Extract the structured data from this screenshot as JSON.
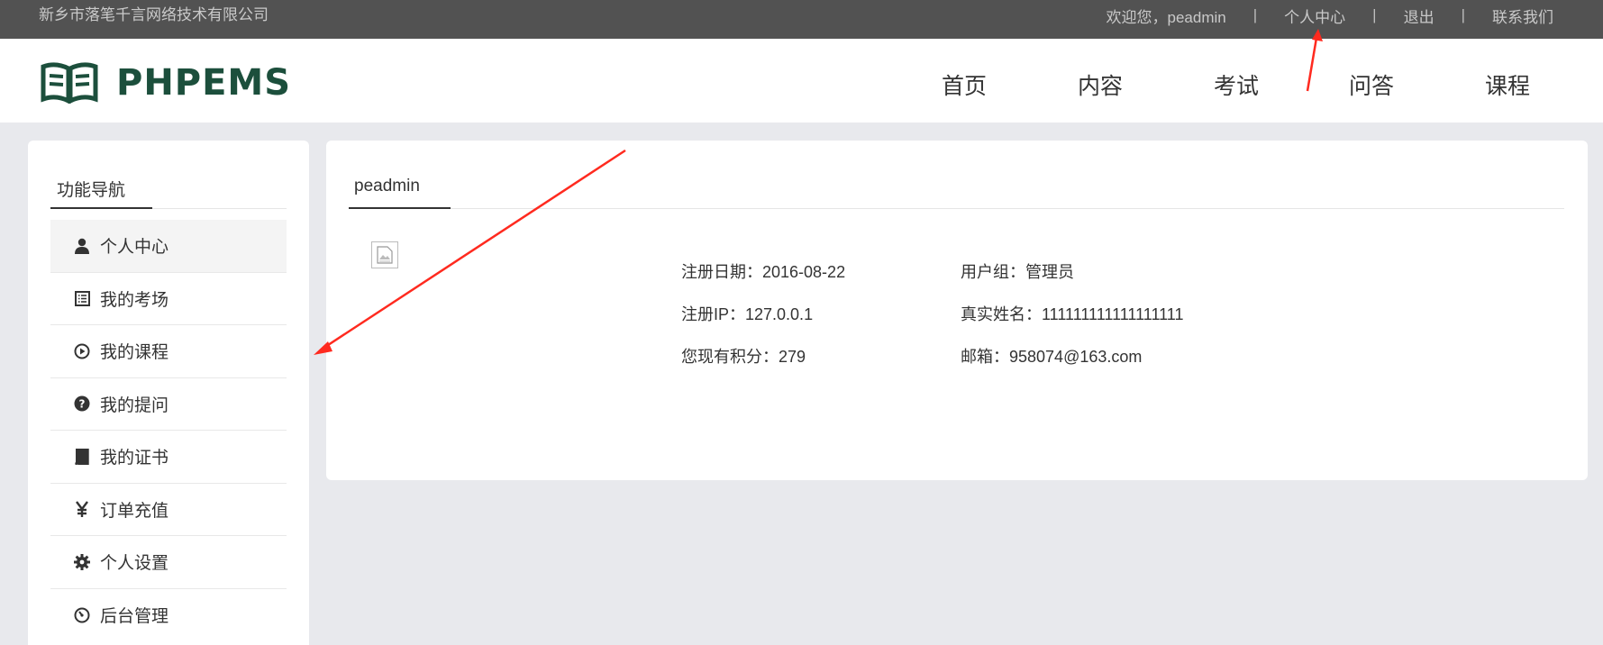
{
  "topbar": {
    "company": "新乡市落笔千言网络技术有限公司",
    "welcome": "欢迎您，peadmin",
    "separator": "|",
    "user_center": "个人中心",
    "logout": "退出",
    "contact": "联系我们"
  },
  "logo": {
    "text": "PHPEMS",
    "icon": "book-logo-icon",
    "color": "#1c4f3c"
  },
  "nav": {
    "home": "首页",
    "content": "内容",
    "exam": "考试",
    "qa": "问答",
    "course": "课程"
  },
  "sidebar": {
    "title": "功能导航",
    "items": [
      {
        "label": "个人中心",
        "icon": "user-icon"
      },
      {
        "label": "我的考场",
        "icon": "list-icon"
      },
      {
        "label": "我的课程",
        "icon": "play-circle-icon"
      },
      {
        "label": "我的提问",
        "icon": "question-circle-icon"
      },
      {
        "label": "我的证书",
        "icon": "book-icon"
      },
      {
        "label": "订单充值",
        "icon": "yen-icon"
      },
      {
        "label": "个人设置",
        "icon": "gear-icon"
      },
      {
        "label": "后台管理",
        "icon": "dashboard-icon"
      }
    ]
  },
  "main": {
    "tab": "peadmin",
    "avatar_icon": "broken-image-icon",
    "info": {
      "reg_date": "注册日期：2016-08-22",
      "user_group": "用户组：管理员",
      "reg_ip": "注册IP：127.0.0.1",
      "real_name": "真实姓名：111111111111111111",
      "points": "您现有积分：279",
      "email": "邮箱：958074@163.com"
    }
  },
  "annotation_color": "#ff2a1f"
}
